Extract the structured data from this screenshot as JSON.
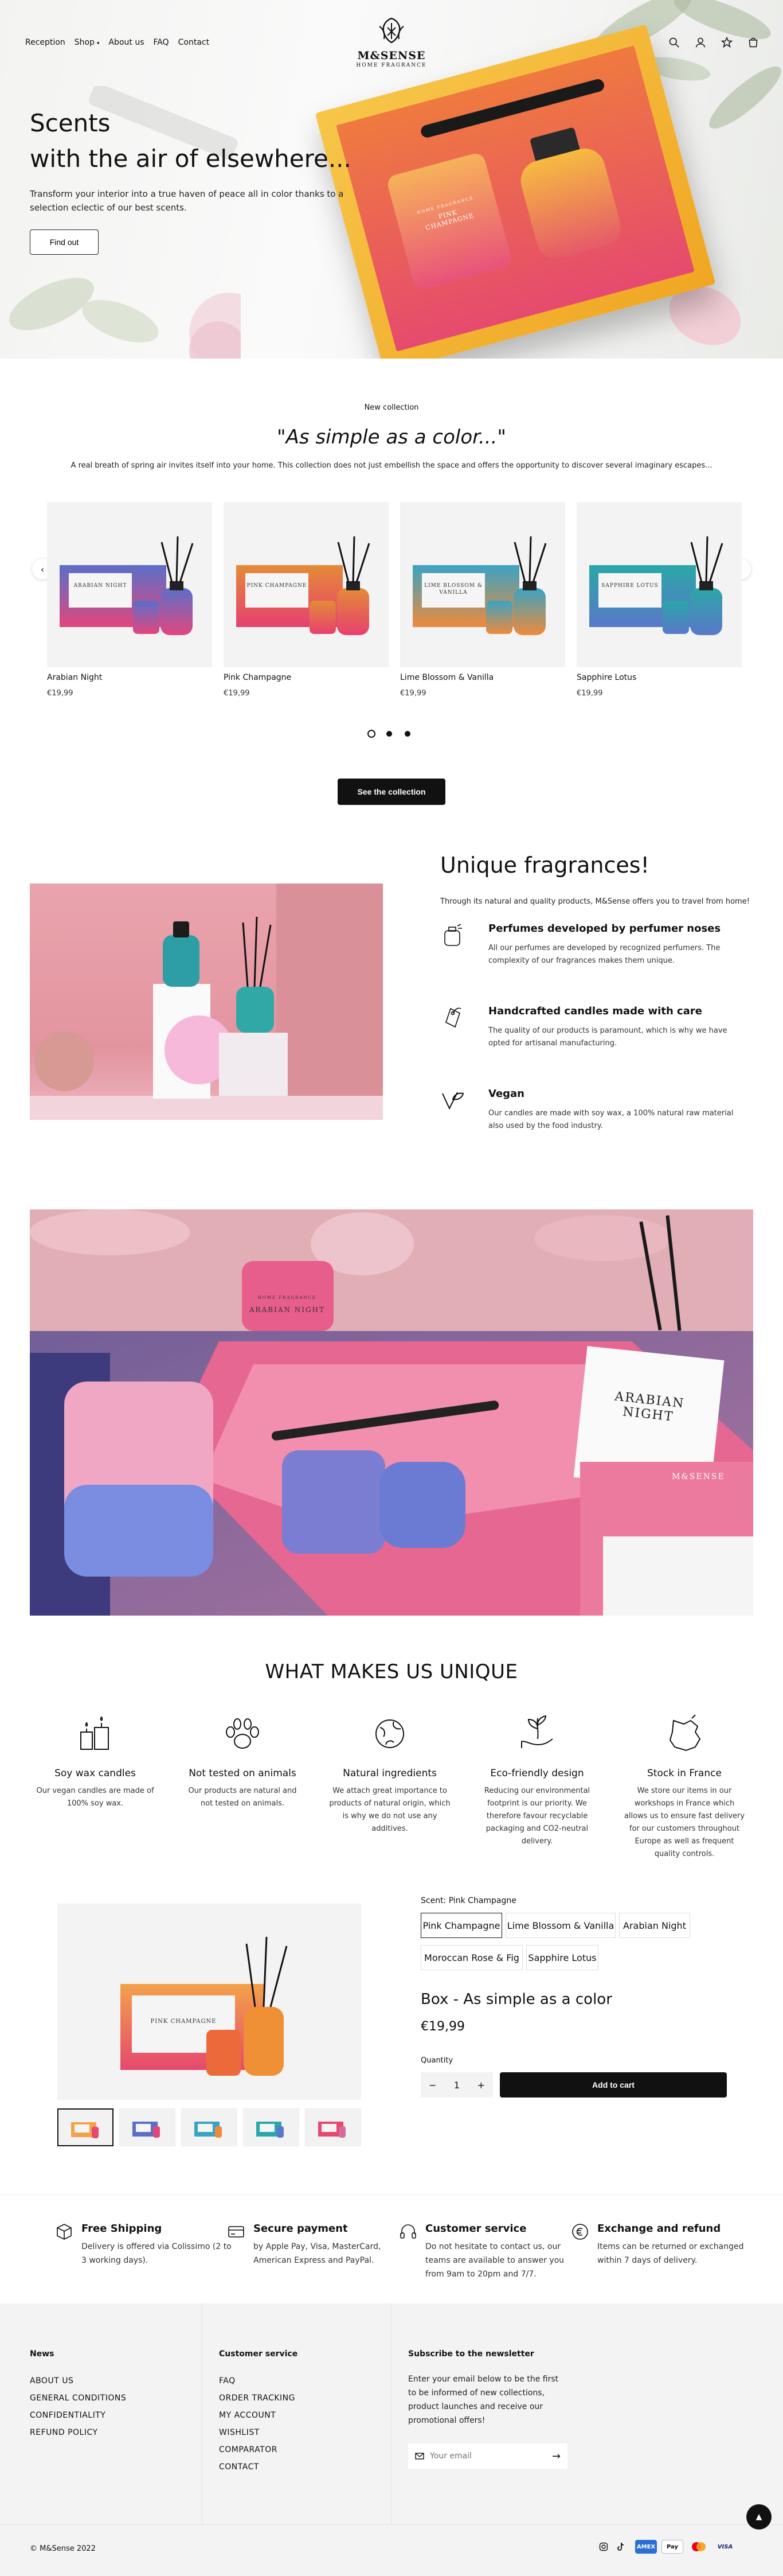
{
  "header": {
    "nav": [
      "Reception",
      "Shop",
      "About us",
      "FAQ",
      "Contact"
    ],
    "brand": "M&SENSE",
    "brand_sub": "HOME FRAGRANCE",
    "icons": [
      "search-icon",
      "account-icon",
      "wishlist-icon",
      "cart-icon"
    ]
  },
  "hero": {
    "title_line1": "Scents",
    "title_line2": "with the air of elsewhere...",
    "description": "Transform your interior into a true haven of peace all in color thanks to a selection eclectic of our best scents.",
    "button": "Find out",
    "box_label_brand": "HOME FRAGRANCE",
    "box_label": "PINK CHAMPAGNE"
  },
  "collection": {
    "eyebrow": "New collection",
    "title": "\"As simple as a color...\"",
    "description": "A real breath of spring air invites itself into your home. This collection does not just embellish the space and offers the opportunity to discover several imaginary escapes...",
    "products": [
      {
        "name": "Arabian Night",
        "price": "€19,99",
        "label": "ARABIAN NIGHT",
        "color_a": "#5a6fc9",
        "color_b": "#e2467d"
      },
      {
        "name": "Pink Champagne",
        "price": "€19,99",
        "label": "PINK CHAMPAGNE",
        "color_a": "#e58b37",
        "color_b": "#e6406f"
      },
      {
        "name": "Lime Blossom & Vanilla",
        "price": "€19,99",
        "label": "LIME BLOSSOM & VANILLA",
        "color_a": "#3aa3c4",
        "color_b": "#ef8a3b"
      },
      {
        "name": "Sapphire Lotus",
        "price": "€19,99",
        "label": "SAPPHIRE LOTUS",
        "color_a": "#2aa7a8",
        "color_b": "#5a78c9"
      }
    ],
    "button": "See the collection"
  },
  "fragrances": {
    "title": "Unique fragrances!",
    "intro": "Through its natural and quality products, M&Sense offers you to travel from home!",
    "items": [
      {
        "title": "Perfumes developed by perfumer noses",
        "text": "All our perfumes are developed by recognized perfumers. The complexity of our fragrances makes them unique.",
        "icon": "perfume-icon"
      },
      {
        "title": "Handcrafted candles made with care",
        "text": "The quality of our products is paramount, which is why we have opted for artisanal manufacturing.",
        "icon": "tag-icon"
      },
      {
        "title": "Vegan",
        "text": "Our candles are made with soy wax, a 100% natural raw material also used by the food industry.",
        "icon": "vegan-icon"
      }
    ]
  },
  "banner": {
    "label_brand": "HOME FRAGRANCE",
    "label": "ARABIAN NIGHT",
    "label2": "ARABIAN NIGHT",
    "brand": "M&SENSE"
  },
  "unique": {
    "title": "WHAT MAKES US UNIQUE",
    "items": [
      {
        "title": "Soy wax candles",
        "text": "Our vegan candles are made of 100% soy wax.",
        "icon": "candles-icon"
      },
      {
        "title": "Not tested on animals",
        "text": "Our products are natural and not tested on animals.",
        "icon": "paw-icon"
      },
      {
        "title": "Natural ingredients",
        "text": "We attach great importance to products of natural origin, which is why we do not use any additives.",
        "icon": "earth-icon"
      },
      {
        "title": "Eco-friendly design",
        "text": "Reducing our environmental footprint is our priority. We therefore favour recyclable packaging and CO2-neutral delivery.",
        "icon": "plant-hand-icon"
      },
      {
        "title": "Stock in France",
        "text": "We store our items in our workshops in France which allows us to ensure fast delivery for our customers throughout Europe as well as frequent quality controls.",
        "icon": "france-map-icon"
      }
    ]
  },
  "product": {
    "scent_label": "Scent: Pink Champagne",
    "scents": [
      "Pink Champagne",
      "Lime Blossom & Vanilla",
      "Arabian Night",
      "Moroccan Rose & Fig",
      "Sapphire Lotus"
    ],
    "selected_scent": "Pink Champagne",
    "title": "Box - As simple as a color",
    "price": "€19,99",
    "quantity_label": "Quantity",
    "quantity": "1",
    "minus": "−",
    "plus": "+",
    "add_to_cart": "Add to cart",
    "box_label": "PINK CHAMPAGNE"
  },
  "services": [
    {
      "title": "Free Shipping",
      "text": "Delivery is offered via Colissimo (2 to 3 working days).",
      "icon": "box-icon"
    },
    {
      "title": "Secure payment",
      "text": "by Apple Pay, Visa, MasterCard, American Express and PayPal.",
      "icon": "card-icon"
    },
    {
      "title": "Customer service",
      "text": "Do not hesitate to contact us, our teams are available to answer you from 9am to 20pm and 7/7.",
      "icon": "headset-icon"
    },
    {
      "title": "Exchange and refund",
      "text": "Items can be returned or exchanged within 7 days of delivery.",
      "icon": "euro-icon"
    }
  ],
  "footer": {
    "news_title": "News",
    "news_links": [
      "ABOUT US",
      "GENERAL CONDITIONS",
      "CONFIDENTIALITY",
      "REFUND POLICY"
    ],
    "service_title": "Customer service",
    "service_links": [
      "FAQ",
      "ORDER TRACKING",
      "MY ACCOUNT",
      "WISHLIST",
      "COMPARATOR",
      "CONTACT"
    ],
    "newsletter_title": "Subscribe to the newsletter",
    "newsletter_text": "Enter your email below to be the first to be informed of new collections, product launches and receive our promotional offers!",
    "email_placeholder": "Your email",
    "copyright": "© M&Sense 2022",
    "payments": [
      "AMEX",
      "Pay",
      "VISA"
    ]
  }
}
